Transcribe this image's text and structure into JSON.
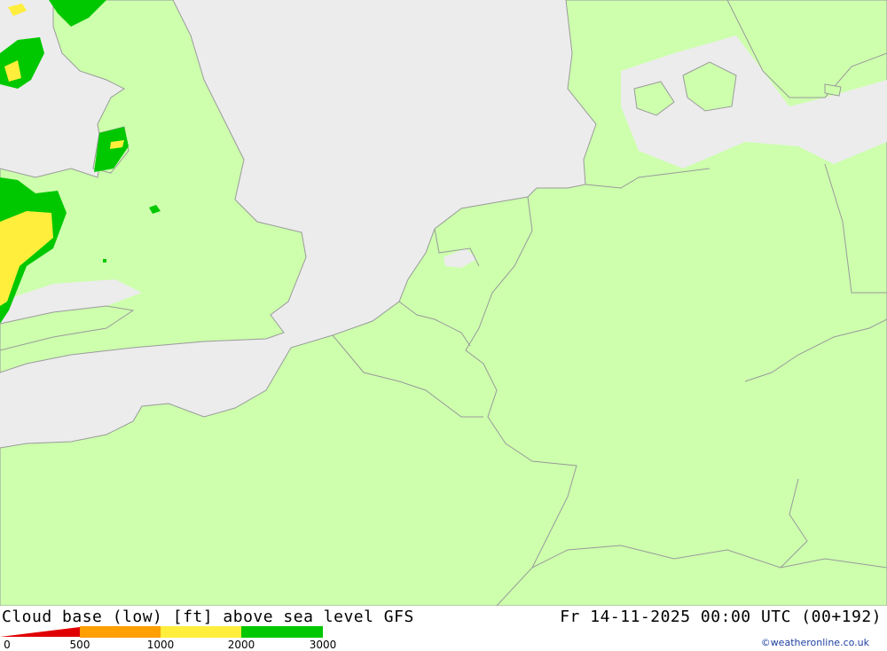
{
  "map": {
    "region": "Western Europe",
    "colors": {
      "sea": "#ececec",
      "land": "#cdffad",
      "border": "#9a9a9a",
      "band_500_1000": "#ff9f00",
      "band_1000_2000": "#ffee3c",
      "band_2000_3000": "#00c800",
      "band_0_500": "#e00000"
    }
  },
  "footer": {
    "title": "Cloud base (low) [ft] above sea level GFS",
    "timestamp": "Fr 14-11-2025 00:00 UTC (00+192)",
    "credit": "©weatheronline.co.uk",
    "legend": {
      "ticks": [
        "0",
        "500",
        "1000",
        "2000",
        "3000"
      ],
      "colors": [
        "#e00000",
        "#ff9f00",
        "#ffee3c",
        "#00c800"
      ]
    }
  }
}
